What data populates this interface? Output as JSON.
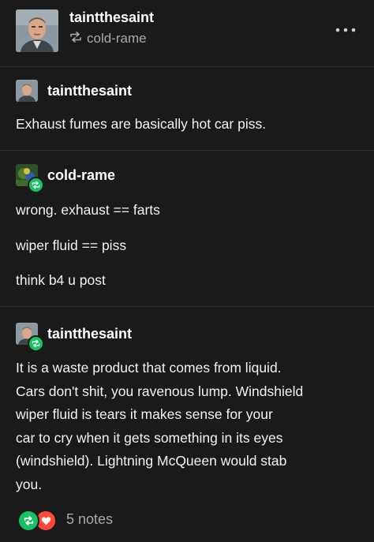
{
  "header": {
    "username": "taintthesaint",
    "reblogged_from": "cold-rame",
    "more_icon": "more-dots-icon"
  },
  "posts": [
    {
      "username": "taintthesaint",
      "lines": [
        "Exhaust fumes are basically hot car piss."
      ]
    },
    {
      "username": "cold-rame",
      "lines": [
        "wrong. exhaust == farts",
        "wiper fluid == piss",
        "think b4 u post"
      ]
    },
    {
      "username": "taintthesaint",
      "lines": [
        "It is a waste product that comes from liquid.",
        "Cars don't shit, you ravenous lump. Windshield",
        "wiper fluid is tears it makes sense for your",
        "car to cry when it gets something in its eyes",
        "(windshield). Lightning McQueen would stab",
        "you."
      ]
    }
  ],
  "footer": {
    "notes": "5 notes",
    "icons": [
      "reblog-icon",
      "heart-icon"
    ]
  },
  "colors": {
    "background": "#1a1a1a",
    "reblog_green": "#18c163",
    "heart_red": "#ff4a3b",
    "muted_text": "#a8a8a8"
  }
}
